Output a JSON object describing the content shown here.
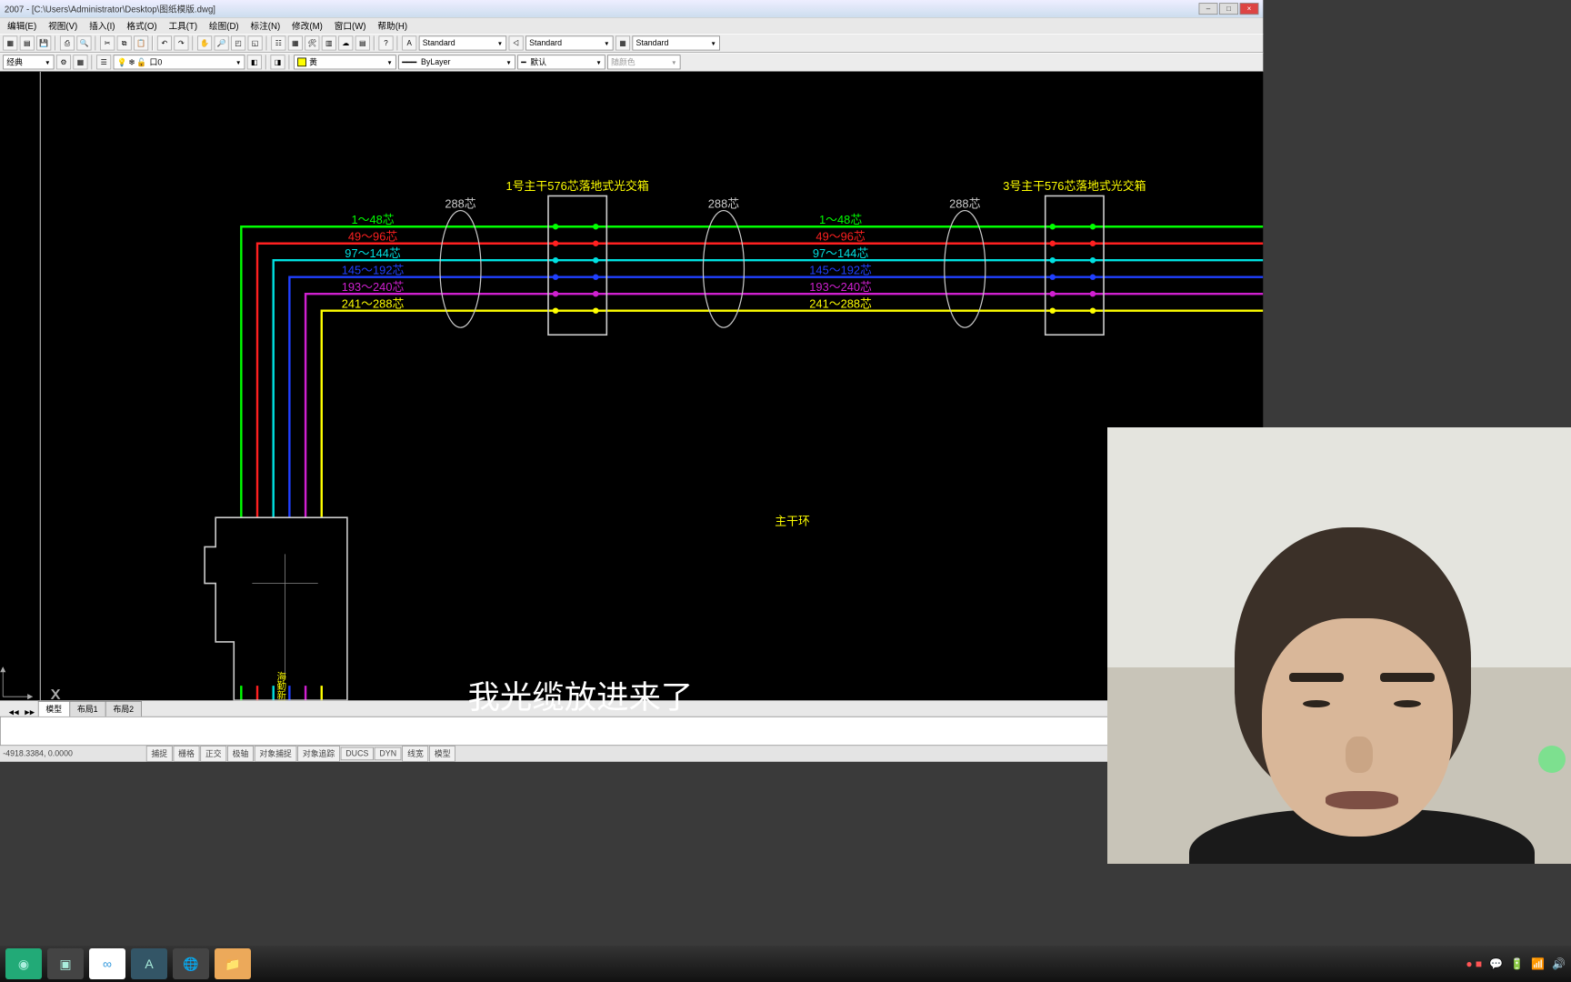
{
  "title": "2007 - [C:\\Users\\Administrator\\Desktop\\图纸模版.dwg]",
  "menu": [
    "编辑(E)",
    "视图(V)",
    "插入(I)",
    "格式(O)",
    "工具(T)",
    "绘图(D)",
    "标注(N)",
    "修改(M)",
    "窗口(W)",
    "帮助(H)"
  ],
  "layer_combo": "口0",
  "style_combo": "经典",
  "textstyle1": "Standard",
  "textstyle2": "Standard",
  "textstyle3": "Standard",
  "color_combo": "黄",
  "linetype": "ByLayer",
  "lineweight": "默认",
  "random_color": "随颜色",
  "tabs": [
    "模型",
    "布局1",
    "布局2"
  ],
  "coords": "-4918.3384, 0.0000",
  "status_toggles": [
    "捕捉",
    "栅格",
    "正交",
    "极轴",
    "对象捕捉",
    "对象追踪",
    "DUCS",
    "DYN",
    "线宽",
    "模型"
  ],
  "labels": {
    "box1": "1号主干576芯落地式光交箱",
    "box3": "3号主干576芯落地式光交箱",
    "c288_1": "288芯",
    "c288_2": "288芯",
    "c288_3": "288芯",
    "r1a": "1～48芯",
    "r1b": "1～48芯",
    "r2a": "49～96芯",
    "r2b": "49～96芯",
    "r3a": "97～144芯",
    "r3b": "97～144芯",
    "r4a": "145～192芯",
    "r4b": "145～192芯",
    "r5a": "193～240芯",
    "r5b": "193～240芯",
    "r6a": "241～288芯",
    "r6b": "241～288芯",
    "trunk": "主干环",
    "room": "海勤新区业务局机房"
  },
  "caption": "我光缆放进来了"
}
